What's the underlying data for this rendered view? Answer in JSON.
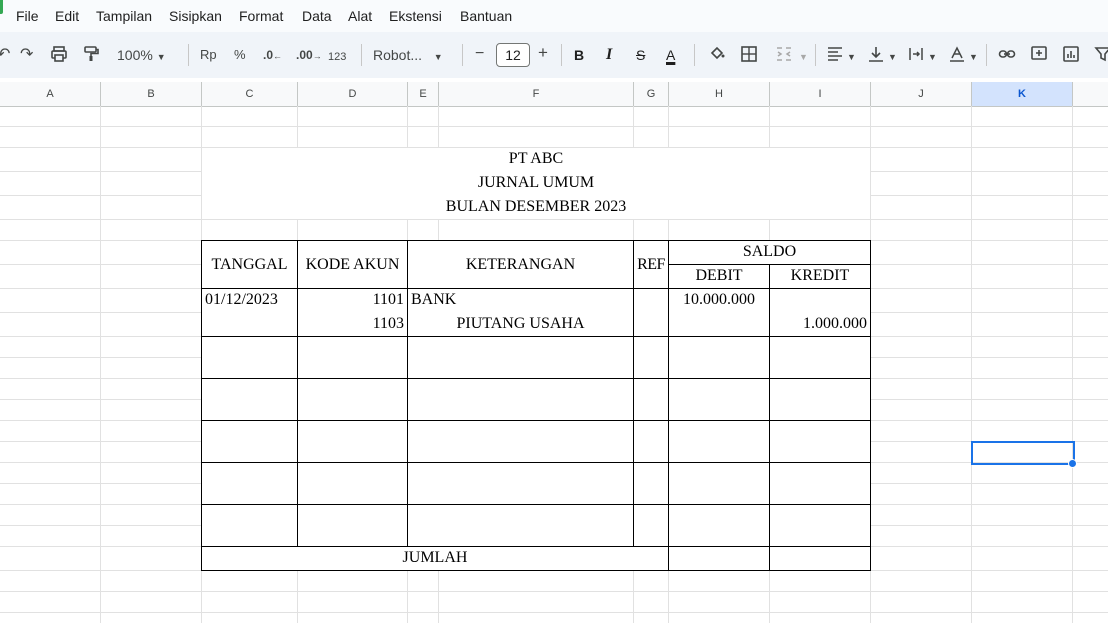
{
  "menu": [
    "File",
    "Edit",
    "Tampilan",
    "Sisipkan",
    "Format",
    "Data",
    "Alat",
    "Ekstensi",
    "Bantuan"
  ],
  "toolbar": {
    "zoom": "100%",
    "currency": "Rp",
    "percent": "%",
    "decrease_decimal": ".0",
    "increase_decimal": ".00",
    "number_format": "123",
    "font": "Robot...",
    "font_size": "12",
    "minus": "−",
    "plus": "+",
    "bold": "B",
    "italic": "I",
    "strike": "S",
    "text_color": "A"
  },
  "columns": [
    "A",
    "B",
    "C",
    "D",
    "E",
    "F",
    "G",
    "H",
    "I",
    "J",
    "K"
  ],
  "selected_column": "K",
  "sheet": {
    "company": "PT ABC",
    "title": "JURNAL UMUM",
    "period": "BULAN DESEMBER 2023",
    "headers": {
      "tanggal": "TANGGAL",
      "kode_akun": "KODE AKUN",
      "keterangan": "KETERANGAN",
      "ref": "REF",
      "saldo": "SALDO",
      "debit": "DEBIT",
      "kredit": "KREDIT"
    },
    "rows": [
      {
        "tanggal": "01/12/2023",
        "kode_akun": "1101",
        "keterangan": "BANK",
        "debit": "10.000.000",
        "kredit": ""
      },
      {
        "tanggal": "",
        "kode_akun": "1103",
        "keterangan": "PIUTANG USAHA",
        "debit": "",
        "kredit": "1.000.000"
      }
    ],
    "jumlah": "JUMLAH"
  },
  "colors": {
    "selection": "#1a73e8",
    "header_selected_bg": "#d3e3fd",
    "toolbar_bg": "#f0f4f9"
  }
}
